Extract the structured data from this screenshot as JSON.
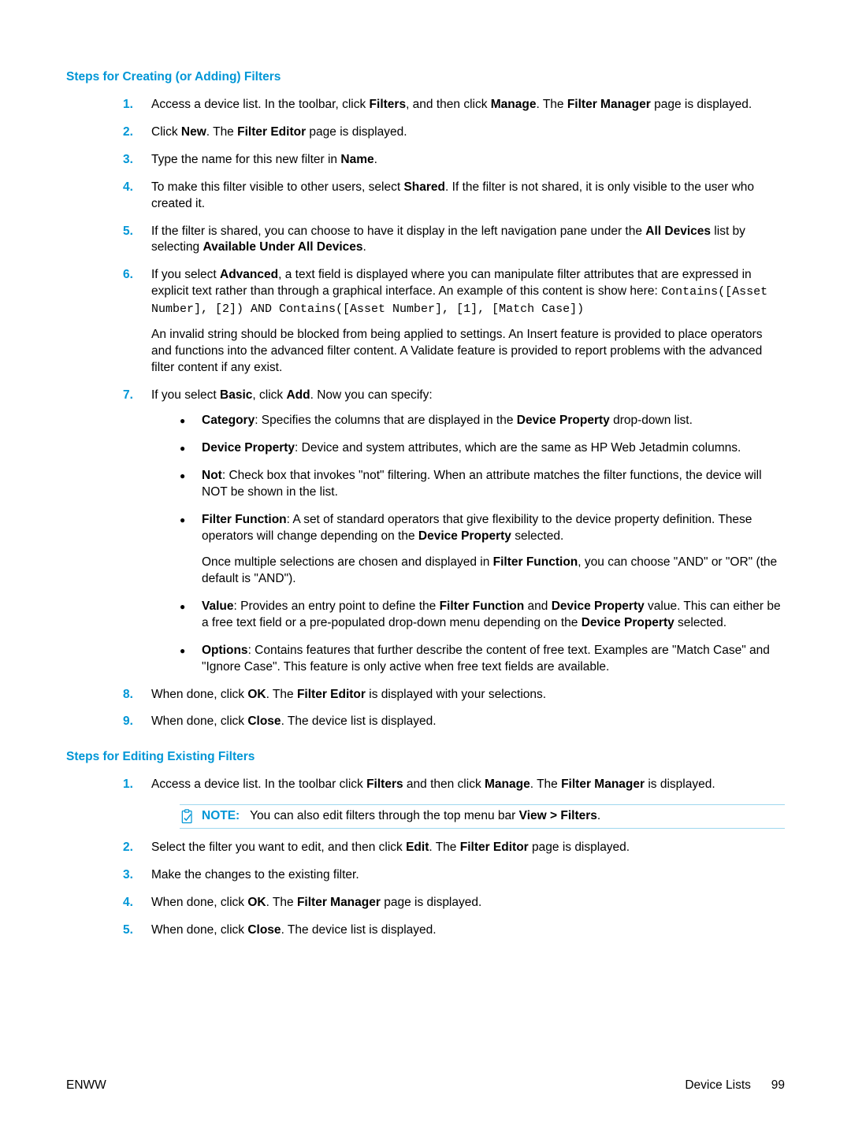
{
  "section1": {
    "heading": "Steps for Creating (or Adding) Filters",
    "steps": [
      {
        "num": "1.",
        "parts": [
          {
            "t": "Access a device list. In the toolbar, click "
          },
          {
            "t": "Filters",
            "b": true
          },
          {
            "t": ", and then click "
          },
          {
            "t": "Manage",
            "b": true
          },
          {
            "t": ". The "
          },
          {
            "t": "Filter Manager",
            "b": true
          },
          {
            "t": " page is displayed."
          }
        ]
      },
      {
        "num": "2.",
        "parts": [
          {
            "t": "Click "
          },
          {
            "t": "New",
            "b": true
          },
          {
            "t": ". The "
          },
          {
            "t": "Filter Editor",
            "b": true
          },
          {
            "t": " page is displayed."
          }
        ]
      },
      {
        "num": "3.",
        "parts": [
          {
            "t": "Type the name for this new filter in "
          },
          {
            "t": "Name",
            "b": true
          },
          {
            "t": "."
          }
        ]
      },
      {
        "num": "4.",
        "parts": [
          {
            "t": "To make this filter visible to other users, select "
          },
          {
            "t": "Shared",
            "b": true
          },
          {
            "t": ". If the filter is not shared, it is only visible to the user who created it."
          }
        ]
      },
      {
        "num": "5.",
        "parts": [
          {
            "t": "If the filter is shared, you can choose to have it display in the left navigation pane under the "
          },
          {
            "t": "All Devices",
            "b": true
          },
          {
            "t": " list by selecting "
          },
          {
            "t": "Available Under All Devices",
            "b": true
          },
          {
            "t": "."
          }
        ]
      },
      {
        "num": "6.",
        "parts": [
          {
            "t": "If you select "
          },
          {
            "t": "Advanced",
            "b": true
          },
          {
            "t": ", a text field is displayed where you can manipulate filter attributes that are expressed in explicit text rather than through a graphical interface. An example of this content is show here: "
          },
          {
            "t": "Contains([Asset Number], [2]) AND Contains([Asset Number], [1], [Match Case])",
            "mono": true
          }
        ],
        "extra": [
          "An invalid string should be blocked from being applied to settings. An Insert feature is provided to place operators and functions into the advanced filter content. A Validate feature is provided to report problems with the advanced filter content if any exist."
        ]
      },
      {
        "num": "7.",
        "parts": [
          {
            "t": "If you select "
          },
          {
            "t": "Basic",
            "b": true
          },
          {
            "t": ", click "
          },
          {
            "t": "Add",
            "b": true
          },
          {
            "t": ". Now you can specify:"
          }
        ],
        "sub": [
          {
            "parts": [
              {
                "t": "Category",
                "b": true
              },
              {
                "t": ": Specifies the columns that are displayed in the "
              },
              {
                "t": "Device Property",
                "b": true
              },
              {
                "t": " drop-down list."
              }
            ]
          },
          {
            "parts": [
              {
                "t": "Device Property",
                "b": true
              },
              {
                "t": ": Device and system attributes, which are the same as HP Web Jetadmin columns."
              }
            ]
          },
          {
            "parts": [
              {
                "t": "Not",
                "b": true
              },
              {
                "t": ": Check box that invokes \"not\" filtering. When an attribute matches the filter functions, the device will NOT be shown in the list."
              }
            ]
          },
          {
            "parts": [
              {
                "t": "Filter Function",
                "b": true
              },
              {
                "t": ": A set of standard operators that give flexibility to the device property definition. These operators will change depending on the "
              },
              {
                "t": "Device Property",
                "b": true
              },
              {
                "t": " selected."
              }
            ],
            "extra_parts": [
              {
                "t": "Once multiple selections are chosen and displayed in "
              },
              {
                "t": "Filter Function",
                "b": true
              },
              {
                "t": ", you can choose \"AND\" or \"OR\" (the default is \"AND\")."
              }
            ]
          },
          {
            "parts": [
              {
                "t": "Value",
                "b": true
              },
              {
                "t": ": Provides an entry point to define the "
              },
              {
                "t": "Filter Function",
                "b": true
              },
              {
                "t": " and "
              },
              {
                "t": "Device Property",
                "b": true
              },
              {
                "t": " value. This can either be a free text field or a pre-populated drop-down menu depending on the "
              },
              {
                "t": "Device Property",
                "b": true
              },
              {
                "t": " selected."
              }
            ]
          },
          {
            "parts": [
              {
                "t": "Options",
                "b": true
              },
              {
                "t": ": Contains features that further describe the content of free text. Examples are \"Match Case\" and \"Ignore Case\". This feature is only active when free text fields are available."
              }
            ]
          }
        ]
      },
      {
        "num": "8.",
        "parts": [
          {
            "t": "When done, click "
          },
          {
            "t": "OK",
            "b": true
          },
          {
            "t": ". The "
          },
          {
            "t": "Filter Editor",
            "b": true
          },
          {
            "t": " is displayed with your selections."
          }
        ]
      },
      {
        "num": "9.",
        "parts": [
          {
            "t": "When done, click "
          },
          {
            "t": "Close",
            "b": true
          },
          {
            "t": ". The device list is displayed."
          }
        ]
      }
    ]
  },
  "section2": {
    "heading": "Steps for Editing Existing Filters",
    "steps": [
      {
        "num": "1.",
        "parts": [
          {
            "t": "Access a device list. In the toolbar click "
          },
          {
            "t": "Filters",
            "b": true
          },
          {
            "t": " and then click "
          },
          {
            "t": "Manage",
            "b": true
          },
          {
            "t": ". The "
          },
          {
            "t": "Filter Manager",
            "b": true
          },
          {
            "t": " is displayed."
          }
        ],
        "note": {
          "label": "NOTE:",
          "parts": [
            {
              "t": "You can also edit filters through the top menu bar "
            },
            {
              "t": "View > Filters",
              "b": true
            },
            {
              "t": "."
            }
          ]
        }
      },
      {
        "num": "2.",
        "parts": [
          {
            "t": "Select the filter you want to edit, and then click "
          },
          {
            "t": "Edit",
            "b": true
          },
          {
            "t": ". The "
          },
          {
            "t": "Filter Editor",
            "b": true
          },
          {
            "t": " page is displayed."
          }
        ]
      },
      {
        "num": "3.",
        "parts": [
          {
            "t": "Make the changes to the existing filter."
          }
        ]
      },
      {
        "num": "4.",
        "parts": [
          {
            "t": "When done, click "
          },
          {
            "t": "OK",
            "b": true
          },
          {
            "t": ". The "
          },
          {
            "t": "Filter Manager",
            "b": true
          },
          {
            "t": " page is displayed."
          }
        ]
      },
      {
        "num": "5.",
        "parts": [
          {
            "t": "When done, click "
          },
          {
            "t": "Close",
            "b": true
          },
          {
            "t": ". The device list is displayed."
          }
        ]
      }
    ]
  },
  "footer": {
    "left": "ENWW",
    "right_label": "Device Lists",
    "right_page": "99"
  }
}
